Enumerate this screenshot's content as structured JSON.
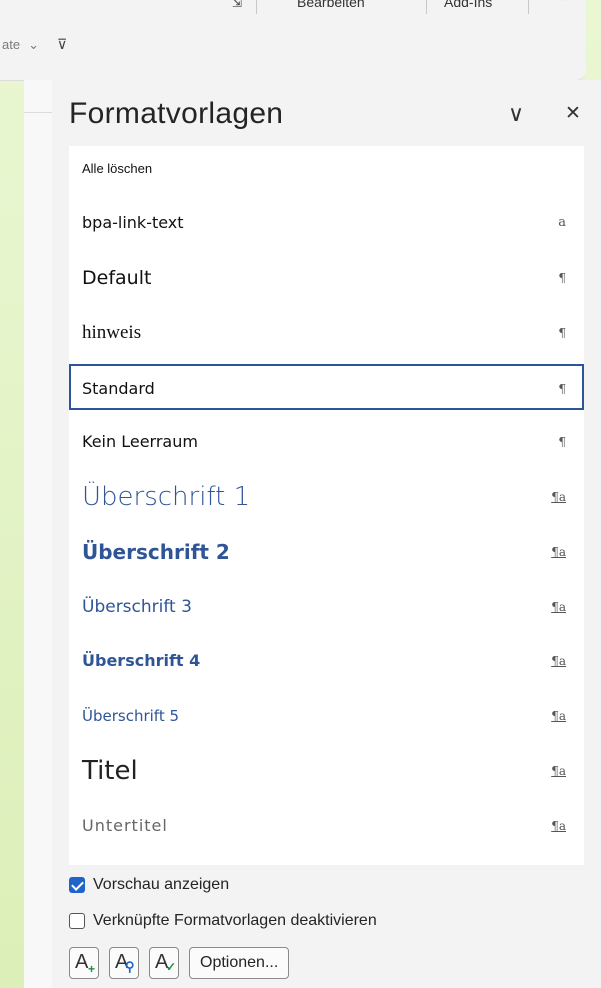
{
  "ribbon": {
    "tabs": [
      "Bearbeiten",
      "Add-Ins"
    ],
    "row2_label": "ate",
    "row2_chevron": "⌄",
    "customize_glyph": "⊽"
  },
  "pane": {
    "title": "Formatvorlagen",
    "collapse_glyph": "∨",
    "close_glyph": "✕"
  },
  "styles": [
    {
      "name": "Alle löschen",
      "mark": ""
    },
    {
      "name": "bpa-link-text",
      "mark": "a"
    },
    {
      "name": "Default",
      "mark": "¶"
    },
    {
      "name": "hinweis",
      "mark": "¶"
    },
    {
      "name": "Standard",
      "mark": "¶",
      "selected": true
    },
    {
      "name": "Kein Leerraum",
      "mark": "¶"
    },
    {
      "name": "Überschrift 1",
      "mark": "¶a"
    },
    {
      "name": "Überschrift 2",
      "mark": "¶a"
    },
    {
      "name": "Überschrift 3",
      "mark": "¶a"
    },
    {
      "name": "Überschrift 4",
      "mark": "¶a"
    },
    {
      "name": "Überschrift 5",
      "mark": "¶a"
    },
    {
      "name": "Titel",
      "mark": "¶a"
    },
    {
      "name": "Untertitel",
      "mark": "¶a"
    }
  ],
  "options": {
    "preview_label": "Vorschau anzeigen",
    "preview_checked": true,
    "linked_label": "Verknüpfte Formatvorlagen deaktivieren",
    "linked_checked": false
  },
  "buttons": {
    "new_style_icon": "new-style-icon",
    "style_inspector_icon": "style-inspector-icon",
    "manage_styles_icon": "manage-styles-icon",
    "options_label": "Optionen..."
  },
  "colors": {
    "accent": "#2b579a",
    "heading_blue": "#2f5597",
    "checkbox": "#1f65c9"
  }
}
